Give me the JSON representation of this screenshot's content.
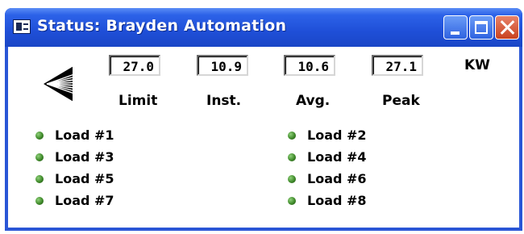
{
  "window": {
    "title": "Status: Brayden Automation",
    "controls": [
      "minimize",
      "maximize",
      "close"
    ]
  },
  "readings": {
    "unit": "KW",
    "items": [
      {
        "label": "Limit",
        "value": "27.0"
      },
      {
        "label": "Inst.",
        "value": "10.9"
      },
      {
        "label": "Avg.",
        "value": "10.6"
      },
      {
        "label": "Peak",
        "value": "27.1"
      }
    ]
  },
  "loads": [
    {
      "label": "Load #1",
      "status_color": "#3f8a2a"
    },
    {
      "label": "Load #2",
      "status_color": "#3f8a2a"
    },
    {
      "label": "Load #3",
      "status_color": "#3f8a2a"
    },
    {
      "label": "Load #4",
      "status_color": "#3f8a2a"
    },
    {
      "label": "Load #5",
      "status_color": "#3f8a2a"
    },
    {
      "label": "Load #6",
      "status_color": "#3f8a2a"
    },
    {
      "label": "Load #7",
      "status_color": "#3f8a2a"
    },
    {
      "label": "Load #8",
      "status_color": "#3f8a2a"
    }
  ],
  "icons": {
    "app": "window-app-icon",
    "logo": "brayden-logo-icon"
  },
  "colors": {
    "titlebar": "#2458d8",
    "close_button": "#d6542d",
    "status_ok": "#3f8a2a"
  }
}
